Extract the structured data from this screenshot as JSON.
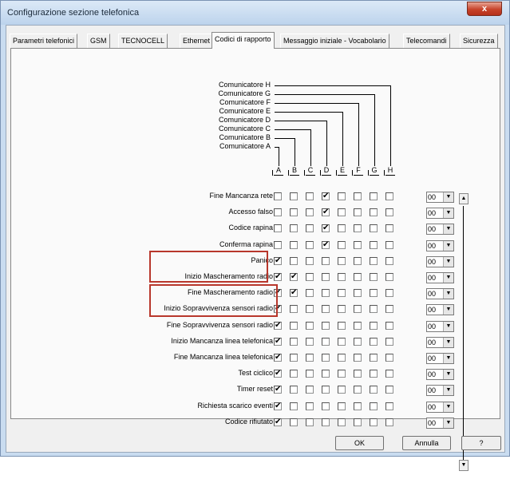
{
  "window": {
    "title": "Configurazione sezione telefonica",
    "close_glyph": "x"
  },
  "tabs": [
    {
      "label": "Parametri telefonici"
    },
    {
      "label": "GSM"
    },
    {
      "label": "TECNOCELL"
    },
    {
      "label": "Ethernet"
    },
    {
      "label": "Codici di rapporto",
      "active": true
    },
    {
      "label": "Messaggio iniziale - Vocabolario"
    },
    {
      "label": "Telecomandi"
    },
    {
      "label": "Sicurezza"
    }
  ],
  "communicators": [
    "Comunicatore H",
    "Comunicatore G",
    "Comunicatore F",
    "Comunicatore E",
    "Comunicatore D",
    "Comunicatore C",
    "Comunicatore B",
    "Comunicatore A"
  ],
  "columns": [
    "A",
    "B",
    "C",
    "D",
    "E",
    "F",
    "G",
    "H"
  ],
  "rows": [
    {
      "label": "Fine Mancanza rete",
      "checks": [
        false,
        false,
        false,
        true,
        false,
        false,
        false,
        false
      ],
      "code": "00"
    },
    {
      "label": "Accesso falso",
      "checks": [
        false,
        false,
        false,
        true,
        false,
        false,
        false,
        false
      ],
      "code": "00"
    },
    {
      "label": "Codice rapina",
      "checks": [
        false,
        false,
        false,
        true,
        false,
        false,
        false,
        false
      ],
      "code": "00"
    },
    {
      "label": "Conferma rapina",
      "checks": [
        false,
        false,
        false,
        true,
        false,
        false,
        false,
        false
      ],
      "code": "00"
    },
    {
      "label": "Panico",
      "checks": [
        true,
        false,
        false,
        false,
        false,
        false,
        false,
        false
      ],
      "code": "00"
    },
    {
      "label": "Inizio Mascheramento radio",
      "checks": [
        true,
        true,
        false,
        false,
        false,
        false,
        false,
        false
      ],
      "code": "00"
    },
    {
      "label": "Fine Mascheramento radio",
      "checks": [
        true,
        true,
        false,
        false,
        false,
        false,
        false,
        false
      ],
      "code": "00"
    },
    {
      "label": "Inizio Sopravvivenza sensori radio",
      "checks": [
        true,
        false,
        false,
        false,
        false,
        false,
        false,
        false
      ],
      "code": "00"
    },
    {
      "label": "Fine Sopravvivenza sensori radio",
      "checks": [
        true,
        false,
        false,
        false,
        false,
        false,
        false,
        false
      ],
      "code": "00"
    },
    {
      "label": "Inizio Mancanza linea telefonica",
      "checks": [
        true,
        false,
        false,
        false,
        false,
        false,
        false,
        false
      ],
      "code": "00"
    },
    {
      "label": "Fine Mancanza linea telefonica",
      "checks": [
        true,
        false,
        false,
        false,
        false,
        false,
        false,
        false
      ],
      "code": "00"
    },
    {
      "label": "Test ciclico",
      "checks": [
        true,
        false,
        false,
        false,
        false,
        false,
        false,
        false
      ],
      "code": "00"
    },
    {
      "label": "Timer reset",
      "checks": [
        true,
        false,
        false,
        false,
        false,
        false,
        false,
        false
      ],
      "code": "00"
    },
    {
      "label": "Richiesta scarico eventi",
      "checks": [
        true,
        false,
        false,
        false,
        false,
        false,
        false,
        false
      ],
      "code": "00"
    },
    {
      "label": "Codice rifiutato",
      "checks": [
        true,
        false,
        false,
        false,
        false,
        false,
        false,
        false
      ],
      "code": "00"
    }
  ],
  "check_glyph": "✔",
  "buttons": {
    "ok": "OK",
    "cancel": "Annulla",
    "help": "?"
  },
  "colors": {
    "highlight_box": "#b8372c"
  }
}
